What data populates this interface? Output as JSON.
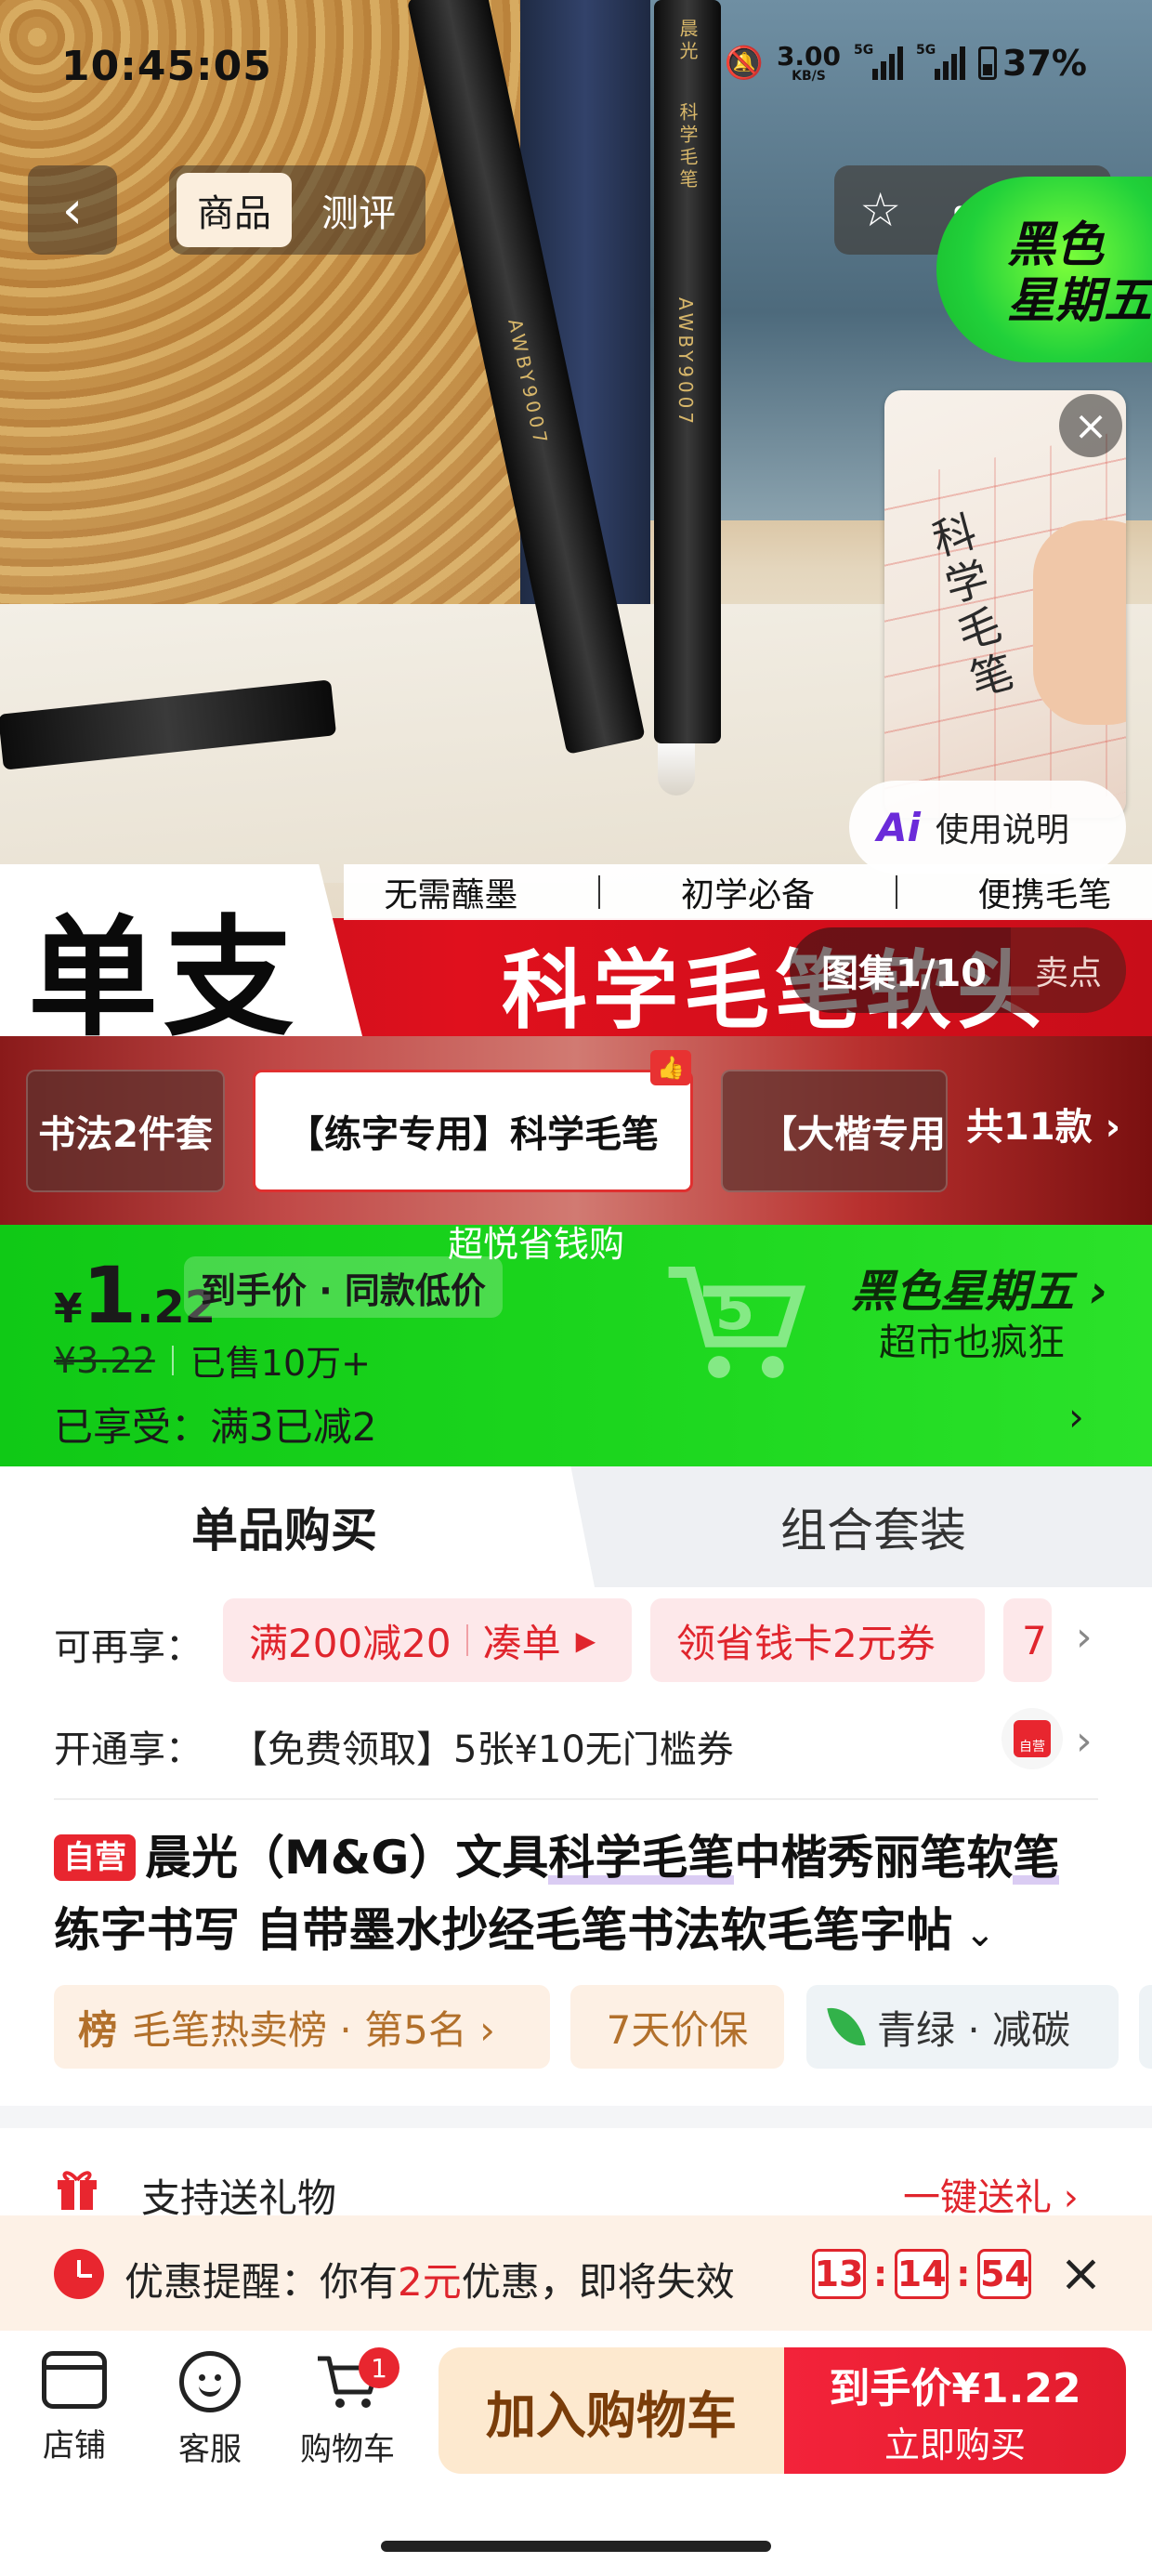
{
  "status_bar": {
    "time": "10:45:05",
    "net_speed": "3.00",
    "net_unit": "KB/S",
    "signal1": "5G",
    "signal2": "5G",
    "battery": "37%"
  },
  "nav": {
    "back_icon": "chevron-left-icon",
    "tabs": [
      {
        "label": "商品",
        "active": true
      },
      {
        "label": "测评",
        "active": false
      }
    ],
    "actions": [
      "star-icon",
      "share-icon",
      "more-icon"
    ]
  },
  "badge": {
    "line1": "黑色",
    "line2": "星期五"
  },
  "hero": {
    "pen_text": "AWBY9007",
    "pen_brand": "晨光",
    "pen_model": "科学毛笔",
    "video_script": "科学毛笔",
    "ai_help": "使用说明",
    "features": [
      "无需蘸墨",
      "初学必备",
      "便携毛笔"
    ],
    "banner_left": "单支",
    "banner_title": "科学毛笔软头",
    "gallery": "图集1/10",
    "selling_point": "卖点"
  },
  "styles": {
    "chips": [
      "书法2件套",
      "【练字专用】科学毛笔",
      "【大楷专用】"
    ],
    "count": "共11款 ›"
  },
  "price": {
    "promo_name": "超悦省钱购",
    "currency": "¥",
    "integer": "1",
    "decimal": ".22",
    "deal_tag": "到手价 · 同款低价",
    "original": "¥3.22",
    "sold": "已售10万+",
    "enjoy": "已享受：满3已减2",
    "bf_title": "黑色星期五 ›",
    "bf_sub": "超市也疯狂",
    "colors": {
      "green": "#1bd51d",
      "red": "#e0252d"
    }
  },
  "purchase_tabs": {
    "single": "单品购买",
    "combo": "组合套装"
  },
  "coupons": {
    "label": "可再享：",
    "items": [
      "满200减20",
      "凑单",
      "领省钱卡2元券",
      "7"
    ],
    "open_label": "开通享：",
    "open_text": "【免费领取】5张¥10无门槛券",
    "jd_label": "自营"
  },
  "title": {
    "badge": "自营",
    "part1": "晨光（M&G）文具",
    "highlight": "科学毛笔",
    "part2": "中楷秀丽笔软",
    "highlight2": "笔",
    "part3": "练字书写 自带墨水抄经毛笔书法软毛笔字帖",
    "expand_icon": "chevron-down-icon"
  },
  "tags": {
    "rank_icon": "榜",
    "rank": "毛笔热卖榜 · 第5名 ›",
    "price_protect": "7天价保",
    "green": "青绿 · 减碳"
  },
  "gift": {
    "text": "支持送礼物",
    "link": "一键送礼 ›"
  },
  "reminder": {
    "prefix": "优惠提醒：你有",
    "amount": "2元",
    "suffix": "优惠，即将失效",
    "h": "13",
    "m": "14",
    "s": "54"
  },
  "bottom_bar": {
    "shop": "店铺",
    "service": "客服",
    "cart": "购物车",
    "cart_count": "1",
    "add_cart": "加入购物车",
    "buy_line1": "到手价¥1.22",
    "buy_line2": "立即购买"
  }
}
